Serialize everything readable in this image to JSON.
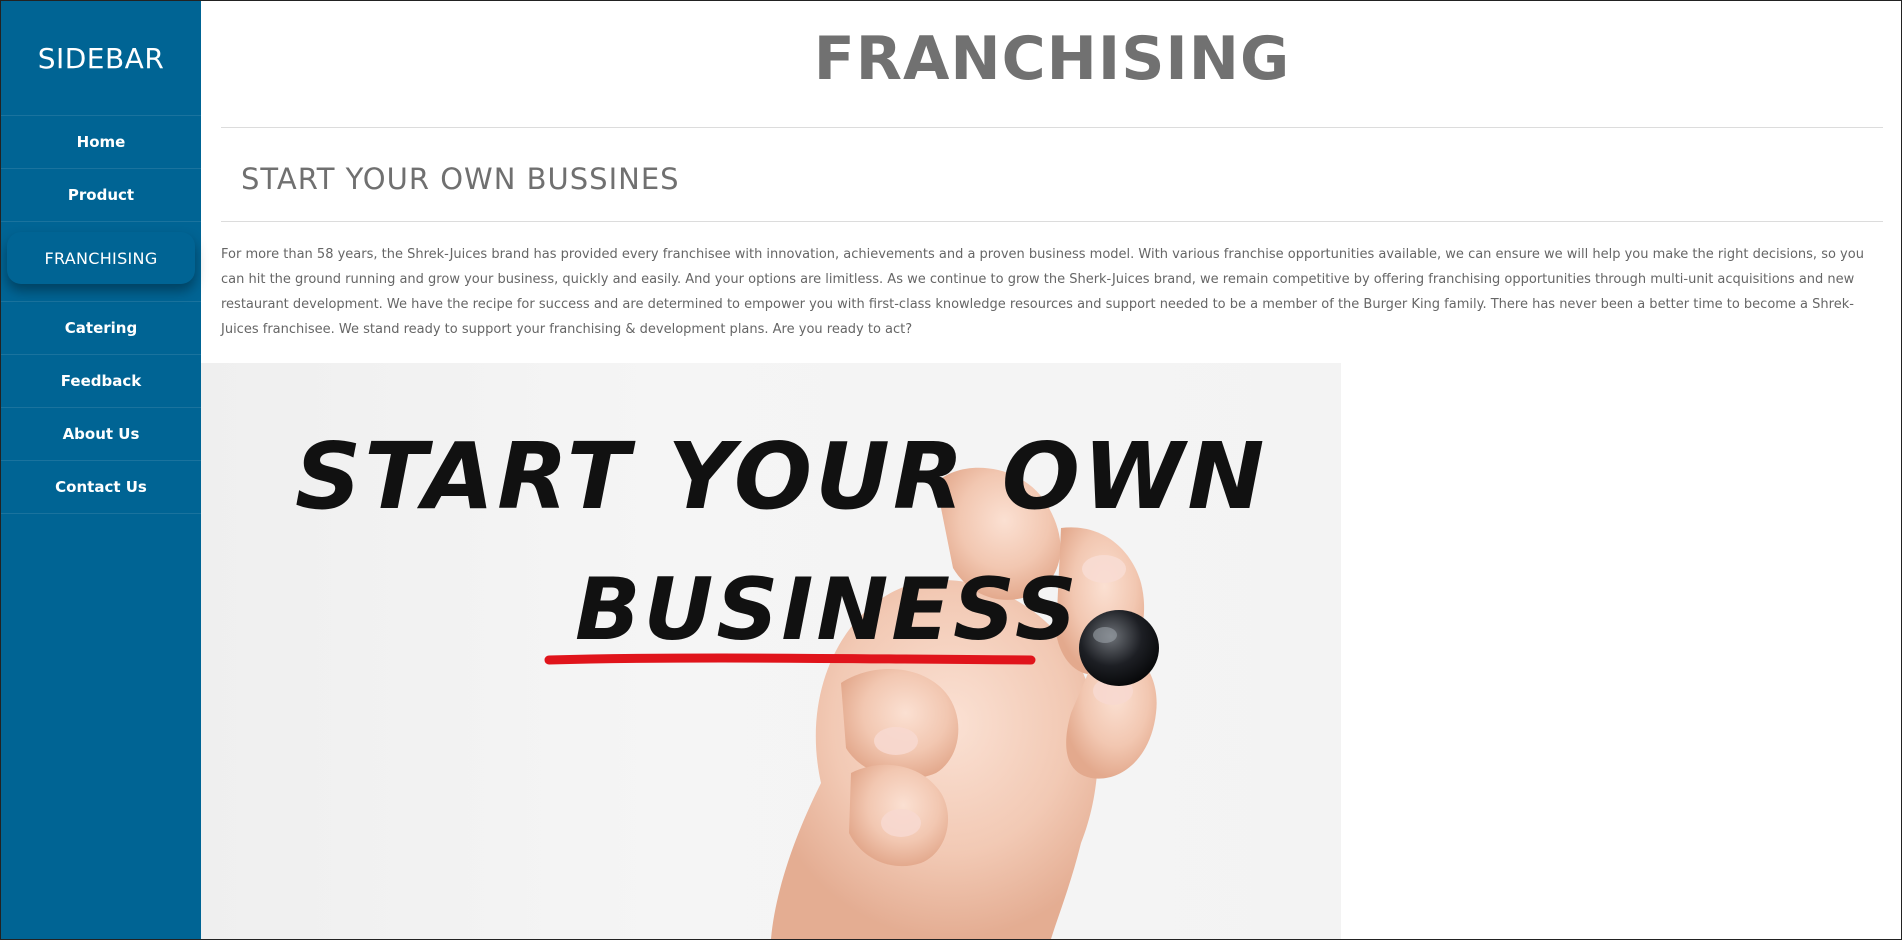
{
  "sidebar": {
    "title": "SIDEBAR",
    "items": [
      {
        "label": "Home"
      },
      {
        "label": "Product"
      },
      {
        "label": "FRANCHISING"
      },
      {
        "label": "Catering"
      },
      {
        "label": "Feedback"
      },
      {
        "label": "About Us"
      },
      {
        "label": "Contact Us"
      }
    ],
    "background": "#006494"
  },
  "main": {
    "title": "FRANCHISING",
    "section_title": "START YOUR OWN BUSSINES",
    "body": "For more than 58 years, the Shrek-Juices brand has provided every franchisee with innovation, achievements and a proven business model. With various franchise opportunities available, we can ensure we will help you make the right decisions, so you can hit the ground running and grow your business, quickly and easily. And your options are limitless. As we continue to grow the Sherk-Juices brand, we remain competitive by offering franchising opportunities through multi-unit acquisitions and new restaurant development. We have the recipe for success and are determined to empower you with first-class knowledge resources and support needed to be a member of the Burger King family. There has never been a better time to become a Shrek-Juices franchisee. We stand ready to support your franchising & development plans. Are you ready to act?",
    "hero": {
      "line1": "START YOUR OWN",
      "line2": "BUSINESS",
      "underline_color": "#e0141b"
    }
  }
}
